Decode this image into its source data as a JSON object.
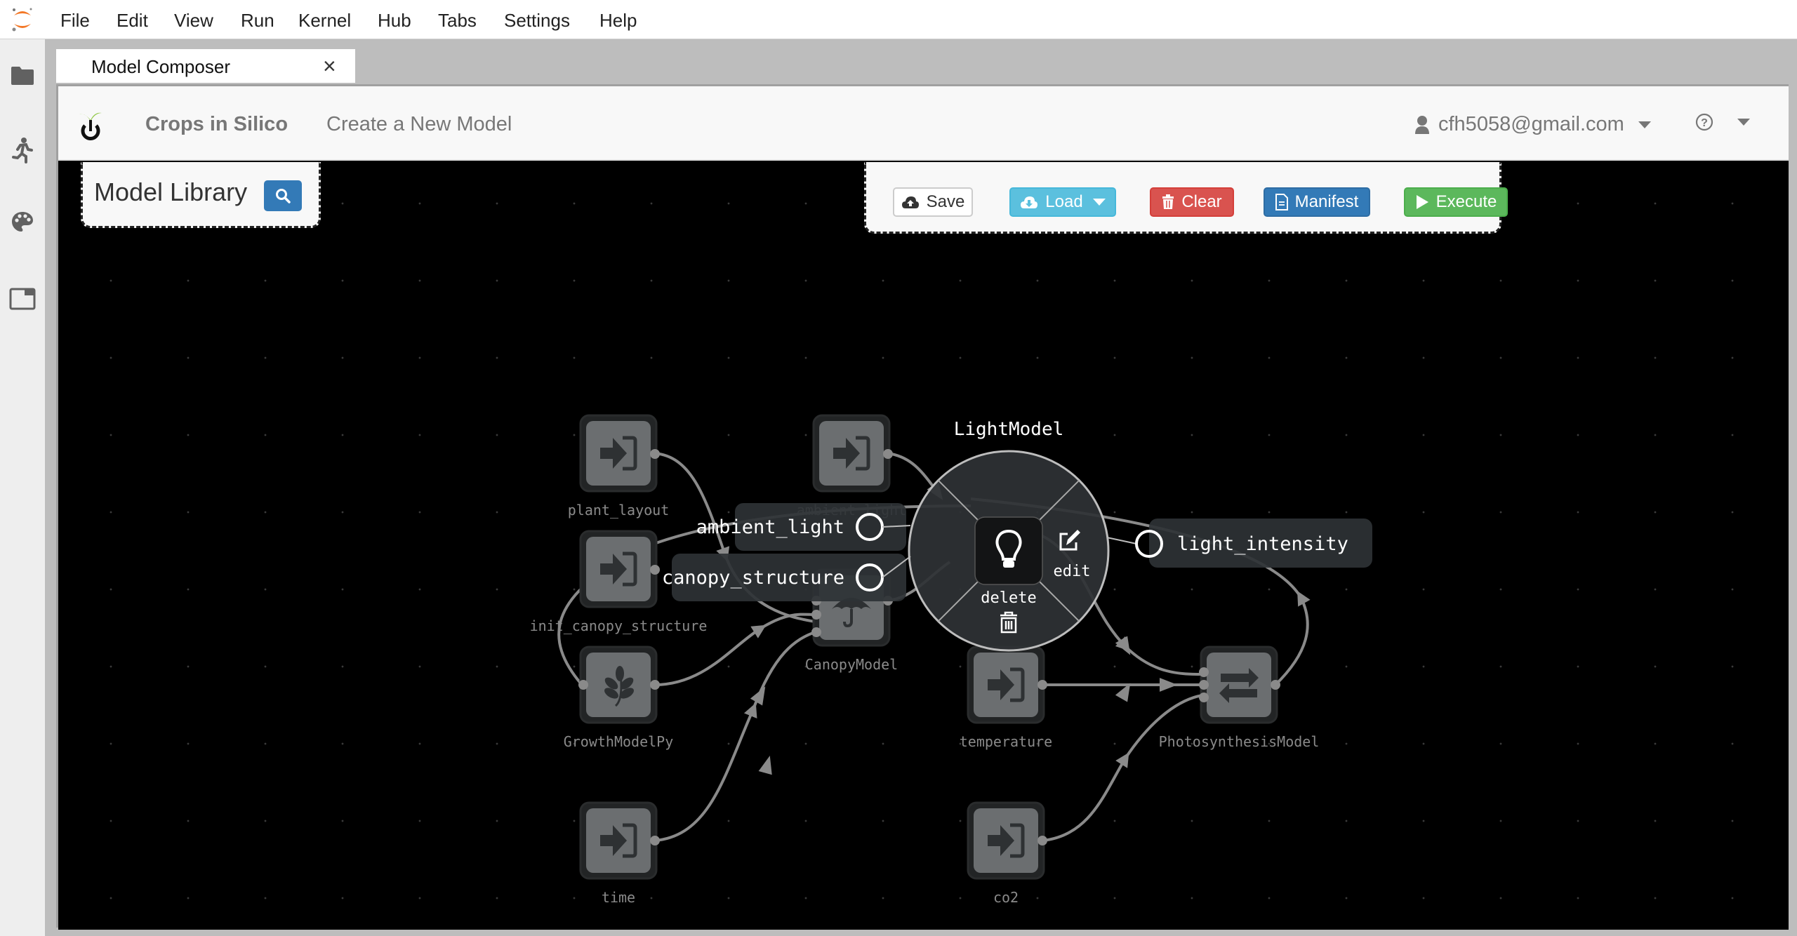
{
  "menubar": {
    "items": [
      "File",
      "Edit",
      "View",
      "Run",
      "Kernel",
      "Hub",
      "Tabs",
      "Settings",
      "Help"
    ]
  },
  "sidebar": {
    "icons": [
      "folder-icon",
      "running-icon",
      "palette-icon",
      "tabs-icon"
    ]
  },
  "tab": {
    "label": "Model Composer",
    "close": "×"
  },
  "navbar": {
    "brand": "Crops in Silico",
    "link": "Create a New Model",
    "user": "cfh5058@gmail.com",
    "help_icon": "?"
  },
  "library": {
    "title": "Model Library"
  },
  "toolbar": {
    "save": "Save",
    "load": "Load",
    "clear": "Clear",
    "manifest": "Manifest",
    "execute": "Execute"
  },
  "colors": {
    "save": "#ffffff",
    "load": "#5bc0de",
    "clear": "#d9534f",
    "manifest": "#337ab7",
    "execute": "#5cb85c",
    "canvas": "#000000",
    "node": "#6b6e70",
    "edge": "#8a8a8a"
  },
  "graph": {
    "nodes": [
      {
        "id": "plant_layout",
        "label": "plant_layout",
        "icon": "input"
      },
      {
        "id": "ambient_light",
        "label": "ambient_light",
        "icon": "input"
      },
      {
        "id": "init_canopy_structure",
        "label": "init_canopy_structure",
        "icon": "input"
      },
      {
        "id": "CanopyModel",
        "label": "CanopyModel",
        "icon": "umbrella"
      },
      {
        "id": "GrowthModelPy",
        "label": "GrowthModelPy",
        "icon": "leaf"
      },
      {
        "id": "time",
        "label": "time",
        "icon": "input"
      },
      {
        "id": "temperature",
        "label": "temperature",
        "icon": "input"
      },
      {
        "id": "PhotosynthesisModel",
        "label": "PhotosynthesisModel",
        "icon": "exchange"
      },
      {
        "id": "co2",
        "label": "co2",
        "icon": "input"
      }
    ],
    "selected": {
      "title": "LightModel",
      "icon": "lightbulb",
      "actions": [
        "edit",
        "delete"
      ],
      "inputs": [
        "ambient_light",
        "canopy_structure"
      ],
      "outputs": [
        "light_intensity"
      ]
    }
  }
}
